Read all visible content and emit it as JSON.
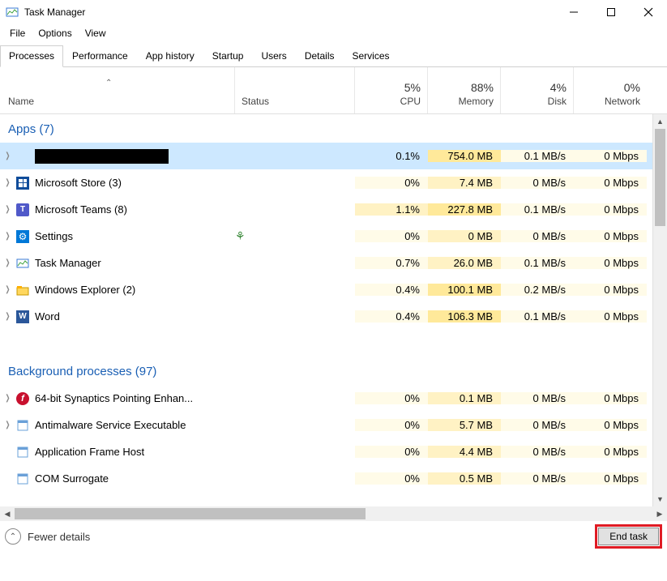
{
  "window": {
    "title": "Task Manager"
  },
  "menu": {
    "file": "File",
    "options": "Options",
    "view": "View"
  },
  "tabs": {
    "processes": "Processes",
    "performance": "Performance",
    "app_history": "App history",
    "startup": "Startup",
    "users": "Users",
    "details": "Details",
    "services": "Services"
  },
  "columns": {
    "name": "Name",
    "status": "Status",
    "cpu_pct": "5%",
    "cpu": "CPU",
    "memory_pct": "88%",
    "memory": "Memory",
    "disk_pct": "4%",
    "disk": "Disk",
    "network_pct": "0%",
    "network": "Network"
  },
  "groups": {
    "apps": "Apps (7)",
    "background": "Background processes (97)"
  },
  "rows": [
    {
      "name": "████████████",
      "expandable": true,
      "selected": true,
      "redacted": true,
      "cpu": "0.1%",
      "mem": "754.0 MB",
      "disk": "0.1 MB/s",
      "net": "0 Mbps",
      "heat": {
        "cpu": "",
        "mem": "heat3",
        "disk": "heat1",
        "net": "heat1"
      }
    },
    {
      "name": "Microsoft Store (3)",
      "expandable": true,
      "icon": "store",
      "cpu": "0%",
      "mem": "7.4 MB",
      "disk": "0 MB/s",
      "net": "0 Mbps",
      "heat": {
        "cpu": "heat1",
        "mem": "heat2",
        "disk": "heat1",
        "net": "heat1"
      }
    },
    {
      "name": "Microsoft Teams (8)",
      "expandable": true,
      "icon": "teams",
      "cpu": "1.1%",
      "mem": "227.8 MB",
      "disk": "0.1 MB/s",
      "net": "0 Mbps",
      "heat": {
        "cpu": "heat2",
        "mem": "heat3",
        "disk": "heat1",
        "net": "heat1"
      }
    },
    {
      "name": "Settings",
      "expandable": true,
      "icon": "settings",
      "leaf": true,
      "cpu": "0%",
      "mem": "0 MB",
      "disk": "0 MB/s",
      "net": "0 Mbps",
      "heat": {
        "cpu": "heat1",
        "mem": "heat2",
        "disk": "heat1",
        "net": "heat1"
      }
    },
    {
      "name": "Task Manager",
      "expandable": true,
      "icon": "taskmgr",
      "cpu": "0.7%",
      "mem": "26.0 MB",
      "disk": "0.1 MB/s",
      "net": "0 Mbps",
      "heat": {
        "cpu": "heat1",
        "mem": "heat2",
        "disk": "heat1",
        "net": "heat1"
      }
    },
    {
      "name": "Windows Explorer (2)",
      "expandable": true,
      "icon": "explorer",
      "cpu": "0.4%",
      "mem": "100.1 MB",
      "disk": "0.2 MB/s",
      "net": "0 Mbps",
      "heat": {
        "cpu": "heat1",
        "mem": "heat3",
        "disk": "heat1",
        "net": "heat1"
      }
    },
    {
      "name": "Word",
      "expandable": true,
      "icon": "word",
      "cpu": "0.4%",
      "mem": "106.3 MB",
      "disk": "0.1 MB/s",
      "net": "0 Mbps",
      "heat": {
        "cpu": "heat1",
        "mem": "heat3",
        "disk": "heat1",
        "net": "heat1"
      }
    }
  ],
  "bg_rows": [
    {
      "name": "64-bit Synaptics Pointing Enhan...",
      "expandable": true,
      "icon": "synaptics",
      "cpu": "0%",
      "mem": "0.1 MB",
      "disk": "0 MB/s",
      "net": "0 Mbps",
      "heat": {
        "cpu": "heat1",
        "mem": "heat2",
        "disk": "heat1",
        "net": "heat1"
      }
    },
    {
      "name": "Antimalware Service Executable",
      "expandable": true,
      "icon": "generic",
      "cpu": "0%",
      "mem": "5.7 MB",
      "disk": "0 MB/s",
      "net": "0 Mbps",
      "heat": {
        "cpu": "heat1",
        "mem": "heat2",
        "disk": "heat1",
        "net": "heat1"
      }
    },
    {
      "name": "Application Frame Host",
      "expandable": false,
      "icon": "generic",
      "cpu": "0%",
      "mem": "4.4 MB",
      "disk": "0 MB/s",
      "net": "0 Mbps",
      "heat": {
        "cpu": "heat1",
        "mem": "heat2",
        "disk": "heat1",
        "net": "heat1"
      }
    },
    {
      "name": "COM Surrogate",
      "expandable": false,
      "icon": "generic",
      "cpu": "0%",
      "mem": "0.5 MB",
      "disk": "0 MB/s",
      "net": "0 Mbps",
      "heat": {
        "cpu": "heat1",
        "mem": "heat2",
        "disk": "heat1",
        "net": "heat1"
      }
    }
  ],
  "footer": {
    "fewer": "Fewer details",
    "endtask": "End task"
  }
}
